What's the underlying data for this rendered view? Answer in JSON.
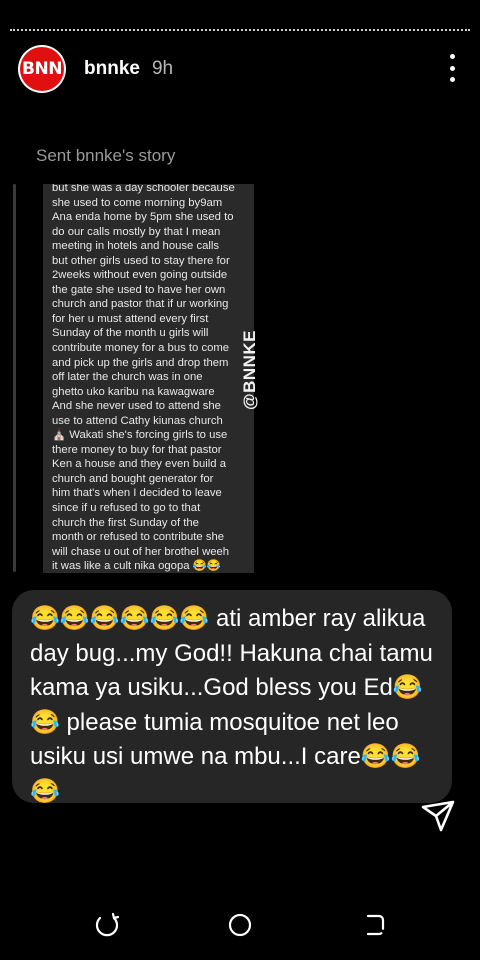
{
  "story_header": {
    "avatar_text": "BNN",
    "username": "bnnke",
    "time": "9h",
    "menu_icon": "more-vert-icon"
  },
  "reply": {
    "sent_label": "Sent bnnke's story",
    "story_text": "but she was a day schooler because\nshe used to come morning by9am\nAna enda home by 5pm she used to\ndo our calls mostly by that I mean\nmeeting in hotels and house calls\nbut other girls used to stay there for\n2weeks without even going outside\nthe gate  she used to have her own\nchurch and pastor that if ur working\nfor her u must attend every first\nSunday of the month u girls will\ncontribute money for a bus to come\nand pick up the girls and drop them\noff later  the church was in one\nghetto uko karibu na kawagware\nAnd she never used to attend she\nuse to attend Cathy kiunas church\n⛪ Wakati she's forcing girls to use\nthere money to buy for that pastor\nKen a house and they even build a\nchurch and bought generator for\nhim  that's when I decided to leave\nsince if u refused to go to that\nchurch the first Sunday of the\nmonth or refused to contribute she\nwill chase u out of her brothel weeh\nit was like a cult nika ogopa 😂😂",
    "watermark": "@BNNKE"
  },
  "message": {
    "text": "😂😂😂😂😂😂 ati amber ray alikua day bug...my God!! Hakuna chai tamu kama ya usiku...God bless you Ed😂😂 please tumia mosquitoe net leo usiku usi umwe na mbu...I care😂😂😂"
  },
  "colors": {
    "background": "#000000",
    "avatar_red": "#e01010",
    "bubble": "#262626",
    "story_card": "#2a2a2a",
    "muted_text": "#9a9a9a"
  },
  "nav": {
    "recents_icon": "recent-apps-icon",
    "home_icon": "home-circle-icon",
    "back_icon": "back-icon"
  }
}
